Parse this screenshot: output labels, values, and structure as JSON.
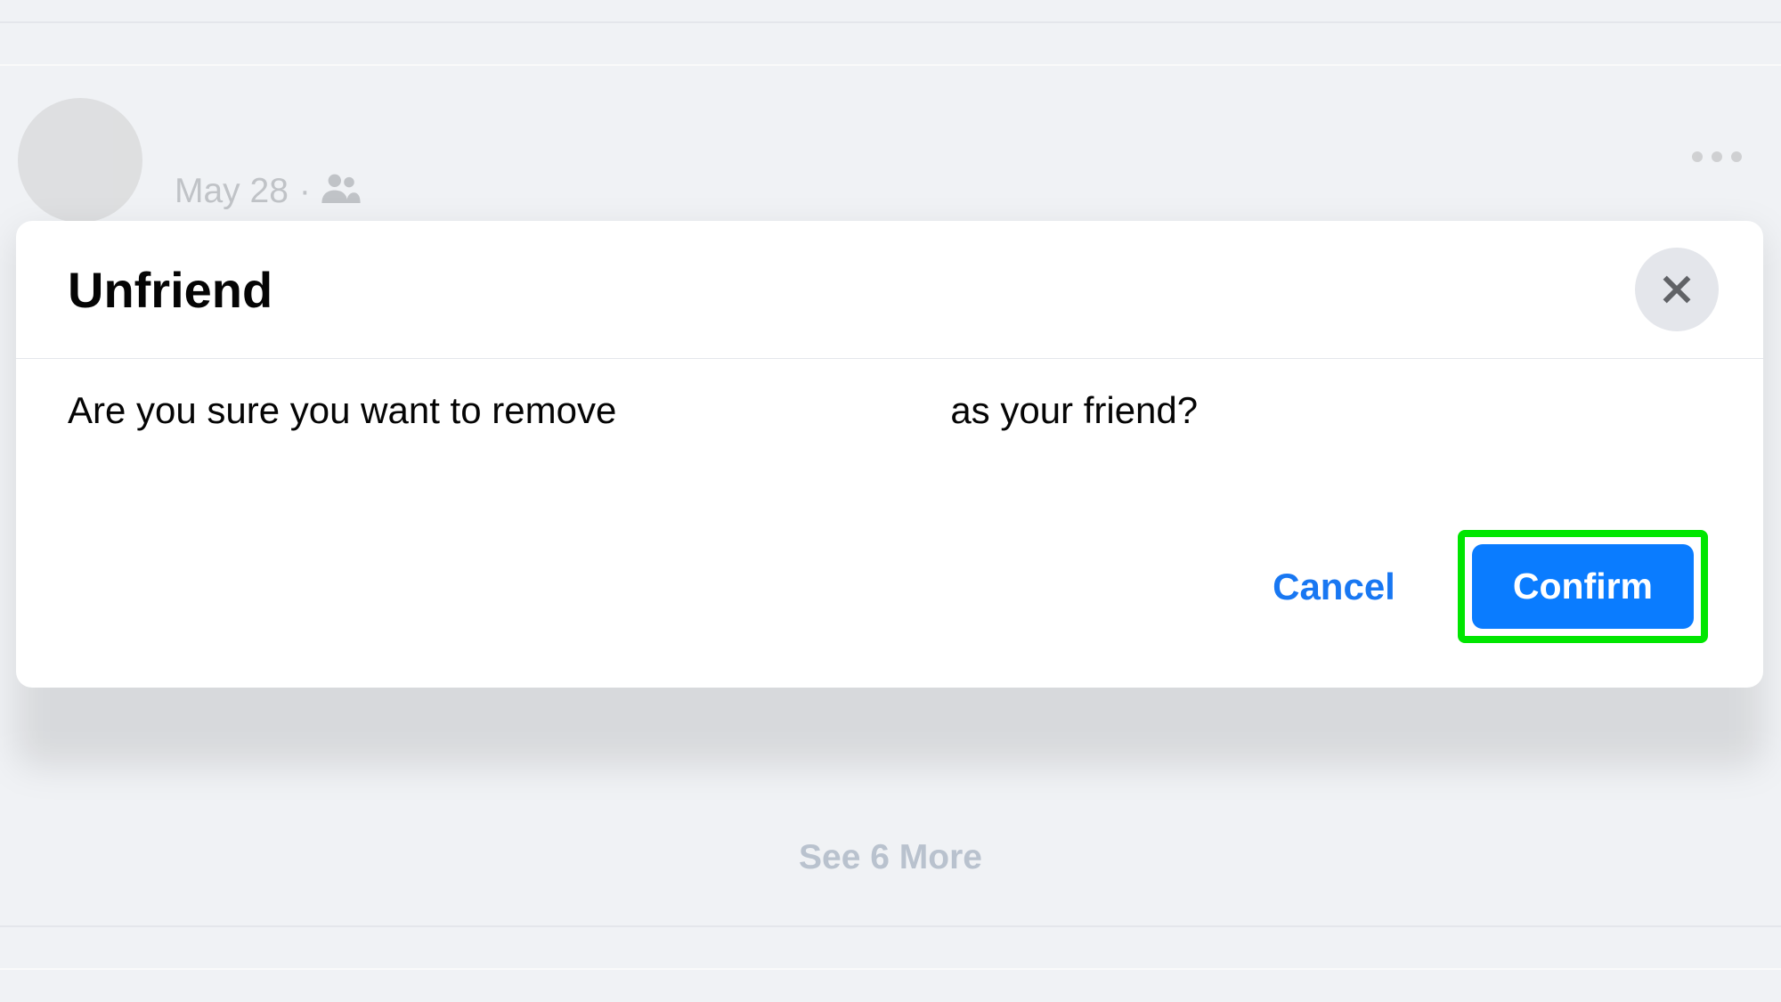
{
  "background": {
    "post_date": "May 28",
    "post_separator": "·",
    "see_more_label": "See 6 More"
  },
  "modal": {
    "title": "Unfriend",
    "body_prefix": "Are you sure you want to remove",
    "body_suffix": "as your friend?",
    "cancel_label": "Cancel",
    "confirm_label": "Confirm"
  }
}
